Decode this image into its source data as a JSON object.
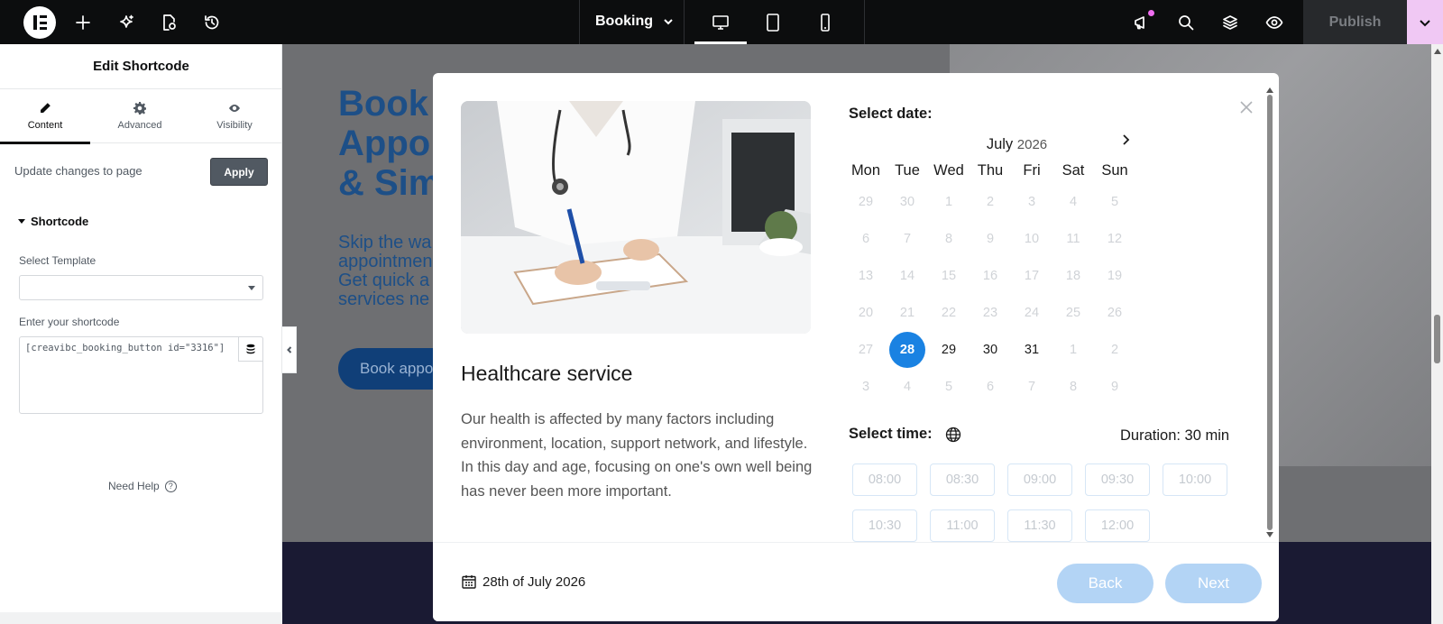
{
  "topbar": {
    "page_name": "Booking",
    "publish_label": "Publish",
    "icons": [
      "elementor-logo-icon",
      "add-icon",
      "ai-sparkle-icon",
      "page-settings-icon",
      "history-icon",
      "notifications-icon",
      "search-icon",
      "structure-layers-icon",
      "preview-eye-icon"
    ],
    "devices": [
      "desktop",
      "tablet",
      "mobile"
    ],
    "active_device": "desktop"
  },
  "panel": {
    "title": "Edit Shortcode",
    "tabs": [
      {
        "label": "Content",
        "icon": "pencil-icon"
      },
      {
        "label": "Advanced",
        "icon": "gear-icon"
      },
      {
        "label": "Visibility",
        "icon": "eye-icon"
      }
    ],
    "active_tab": "Content",
    "update_text": "Update changes to page",
    "apply_label": "Apply",
    "section_title": "Shortcode",
    "select_template_label": "Select Template",
    "select_template_value": "",
    "shortcode_label": "Enter your shortcode",
    "shortcode_value": "[creavibc_booking_button id=\"3316\"]",
    "need_help": "Need Help"
  },
  "canvas": {
    "hero_title": "Book\nAppo\n& Sim",
    "hero_sub": "Skip the wa\nappointmen\nGet quick a\nservices ne",
    "hero_button": "Book appo"
  },
  "modal": {
    "service_title": "Healthcare service",
    "service_desc": "Our health is affected by many factors including environment, location, support network, and lifestyle. In this day and age, focusing on one's own well being has never been more important.",
    "select_date_label": "Select date:",
    "month": "July",
    "year": "2026",
    "weekdays": [
      "Mon",
      "Tue",
      "Wed",
      "Thu",
      "Fri",
      "Sat",
      "Sun"
    ],
    "weeks": [
      [
        {
          "d": "29",
          "s": "muted"
        },
        {
          "d": "30",
          "s": "muted"
        },
        {
          "d": "1",
          "s": "muted"
        },
        {
          "d": "2",
          "s": "muted"
        },
        {
          "d": "3",
          "s": "muted"
        },
        {
          "d": "4",
          "s": "muted"
        },
        {
          "d": "5",
          "s": "muted"
        }
      ],
      [
        {
          "d": "6",
          "s": "muted"
        },
        {
          "d": "7",
          "s": "muted"
        },
        {
          "d": "8",
          "s": "muted"
        },
        {
          "d": "9",
          "s": "muted"
        },
        {
          "d": "10",
          "s": "muted"
        },
        {
          "d": "11",
          "s": "muted"
        },
        {
          "d": "12",
          "s": "muted"
        }
      ],
      [
        {
          "d": "13",
          "s": "muted"
        },
        {
          "d": "14",
          "s": "muted"
        },
        {
          "d": "15",
          "s": "muted"
        },
        {
          "d": "16",
          "s": "muted"
        },
        {
          "d": "17",
          "s": "muted"
        },
        {
          "d": "18",
          "s": "muted"
        },
        {
          "d": "19",
          "s": "muted"
        }
      ],
      [
        {
          "d": "20",
          "s": "muted"
        },
        {
          "d": "21",
          "s": "muted"
        },
        {
          "d": "22",
          "s": "muted"
        },
        {
          "d": "23",
          "s": "muted"
        },
        {
          "d": "24",
          "s": "muted"
        },
        {
          "d": "25",
          "s": "muted"
        },
        {
          "d": "26",
          "s": "muted"
        }
      ],
      [
        {
          "d": "27",
          "s": "muted"
        },
        {
          "d": "28",
          "s": "selected"
        },
        {
          "d": "29",
          "s": "avail"
        },
        {
          "d": "30",
          "s": "avail"
        },
        {
          "d": "31",
          "s": "avail"
        },
        {
          "d": "1",
          "s": "muted"
        },
        {
          "d": "2",
          "s": "muted"
        }
      ],
      [
        {
          "d": "3",
          "s": "muted"
        },
        {
          "d": "4",
          "s": "muted"
        },
        {
          "d": "5",
          "s": "muted"
        },
        {
          "d": "6",
          "s": "muted"
        },
        {
          "d": "7",
          "s": "muted"
        },
        {
          "d": "8",
          "s": "muted"
        },
        {
          "d": "9",
          "s": "muted"
        }
      ]
    ],
    "select_time_label": "Select time:",
    "duration": "Duration: 30 min",
    "time_slots": [
      "08:00",
      "08:30",
      "09:00",
      "09:30",
      "10:00",
      "10:30",
      "11:00",
      "11:30",
      "12:00"
    ],
    "footer_date": "28th of July 2026",
    "back_label": "Back",
    "next_label": "Next"
  },
  "colors": {
    "accent": "#1a82e2",
    "button_disabled": "#b3d4f5",
    "topbar": "#0c0d0e",
    "publish_accent": "#f0c8f4"
  }
}
